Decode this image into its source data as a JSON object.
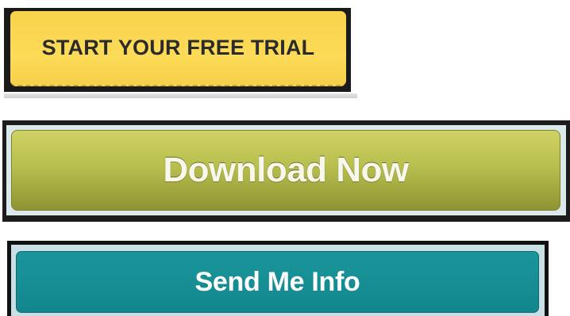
{
  "buttons": {
    "trial": {
      "label": "START YOUR FREE TRIAL",
      "background_color": "#fcdb58",
      "text_color": "#2b2b2b"
    },
    "download": {
      "label": "Download Now",
      "background_color": "#b8bf4e",
      "text_color": "#f7f7ec"
    },
    "info": {
      "label": "Send Me Info",
      "background_color": "#12878d",
      "text_color": "#ffffff"
    }
  }
}
